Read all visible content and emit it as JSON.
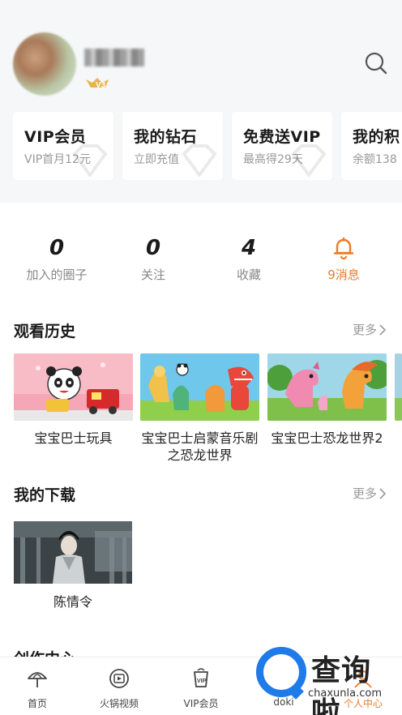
{
  "header": {
    "vip_level": "V3"
  },
  "cards": [
    {
      "title": "VIP会员",
      "sub": "VIP首月12元"
    },
    {
      "title": "我的钻石",
      "sub": "立即充值"
    },
    {
      "title": "免费送VIP",
      "sub": "最高得29天"
    },
    {
      "title": "我的积",
      "sub": "余额138"
    }
  ],
  "stats": [
    {
      "num": "0",
      "label": "加入的圈子"
    },
    {
      "num": "0",
      "label": "关注"
    },
    {
      "num": "4",
      "label": "收藏"
    },
    {
      "label": "9消息"
    }
  ],
  "history": {
    "title": "观看历史",
    "more": "更多",
    "items": [
      {
        "caption": "宝宝巴士玩具"
      },
      {
        "caption": "宝宝巴士启蒙音乐剧之恐龙世界"
      },
      {
        "caption": "宝宝巴士恐龙世界2"
      }
    ]
  },
  "downloads": {
    "title": "我的下载",
    "more": "更多",
    "items": [
      {
        "caption": "陈情令"
      }
    ]
  },
  "creation": {
    "title": "创作中心"
  },
  "nav": [
    {
      "label": "首页",
      "icon": "umbrella-icon"
    },
    {
      "label": "火锅视频",
      "icon": "video-icon"
    },
    {
      "label": "VIP会员",
      "icon": "vip-cup-icon"
    },
    {
      "label": "doki",
      "icon": "doki-icon"
    },
    {
      "label": "个人中心",
      "icon": "profile-icon"
    }
  ],
  "watermark": {
    "text": "查询啦",
    "url": "chaxunla.com"
  },
  "colors": {
    "accent_orange": "#ee7a27",
    "vip_gold": "#e8b44a",
    "watermark_blue": "#1e7be8"
  }
}
